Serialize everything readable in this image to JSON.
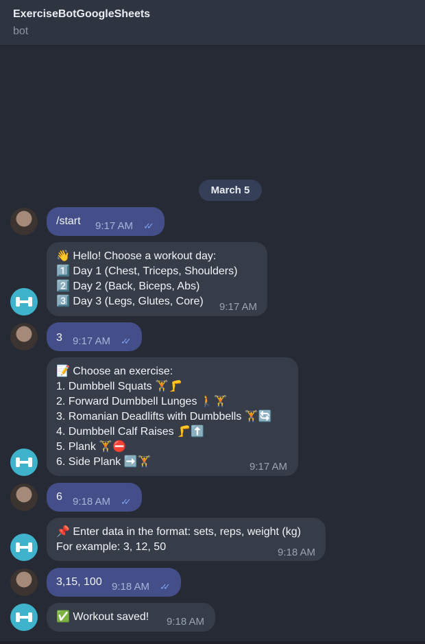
{
  "header": {
    "title": "ExerciseBotGoogleSheets",
    "subtitle": "bot"
  },
  "date_separator": "March 5",
  "messages": [
    {
      "lines": [
        "/start"
      ],
      "time": "9:17 AM"
    },
    {
      "lines": [
        "👋 Hello! Choose a workout day:",
        "1️⃣ Day 1 (Chest, Triceps, Shoulders)",
        "2️⃣ Day 2 (Back, Biceps, Abs)",
        "3️⃣ Day 3 (Legs, Glutes, Core)"
      ],
      "time": "9:17 AM"
    },
    {
      "lines": [
        "3"
      ],
      "time": "9:17 AM"
    },
    {
      "lines": [
        "📝 Choose an exercise:",
        "1. Dumbbell Squats 🏋️🦵",
        "2. Forward Dumbbell Lunges 🚶🏋️",
        "3. Romanian Deadlifts with Dumbbells 🏋️🔄",
        "4. Dumbbell Calf Raises 🦵⬆️",
        "5. Plank 🏋️⛔",
        "6. Side Plank ➡️🏋️"
      ],
      "time": "9:17 AM"
    },
    {
      "lines": [
        "6"
      ],
      "time": "9:18 AM"
    },
    {
      "lines": [
        "📌 Enter data in the format: sets, reps, weight (kg)",
        "For example: 3, 12, 50"
      ],
      "time": "9:18 AM"
    },
    {
      "lines": [
        "3,15, 100"
      ],
      "time": "9:18 AM"
    },
    {
      "lines": [
        "✅ Workout saved!"
      ],
      "time": "9:18 AM"
    }
  ],
  "icons": {
    "read_receipt": "double-check-icon",
    "user_avatar": "user-avatar-photo",
    "bot_avatar": "dumbbell-icon"
  },
  "colors": {
    "background": "#262a35",
    "header": "#2f3540",
    "outgoing_bubble": "#444f8a",
    "incoming_bubble": "#363d49",
    "check_color": "#7fa1ee"
  }
}
